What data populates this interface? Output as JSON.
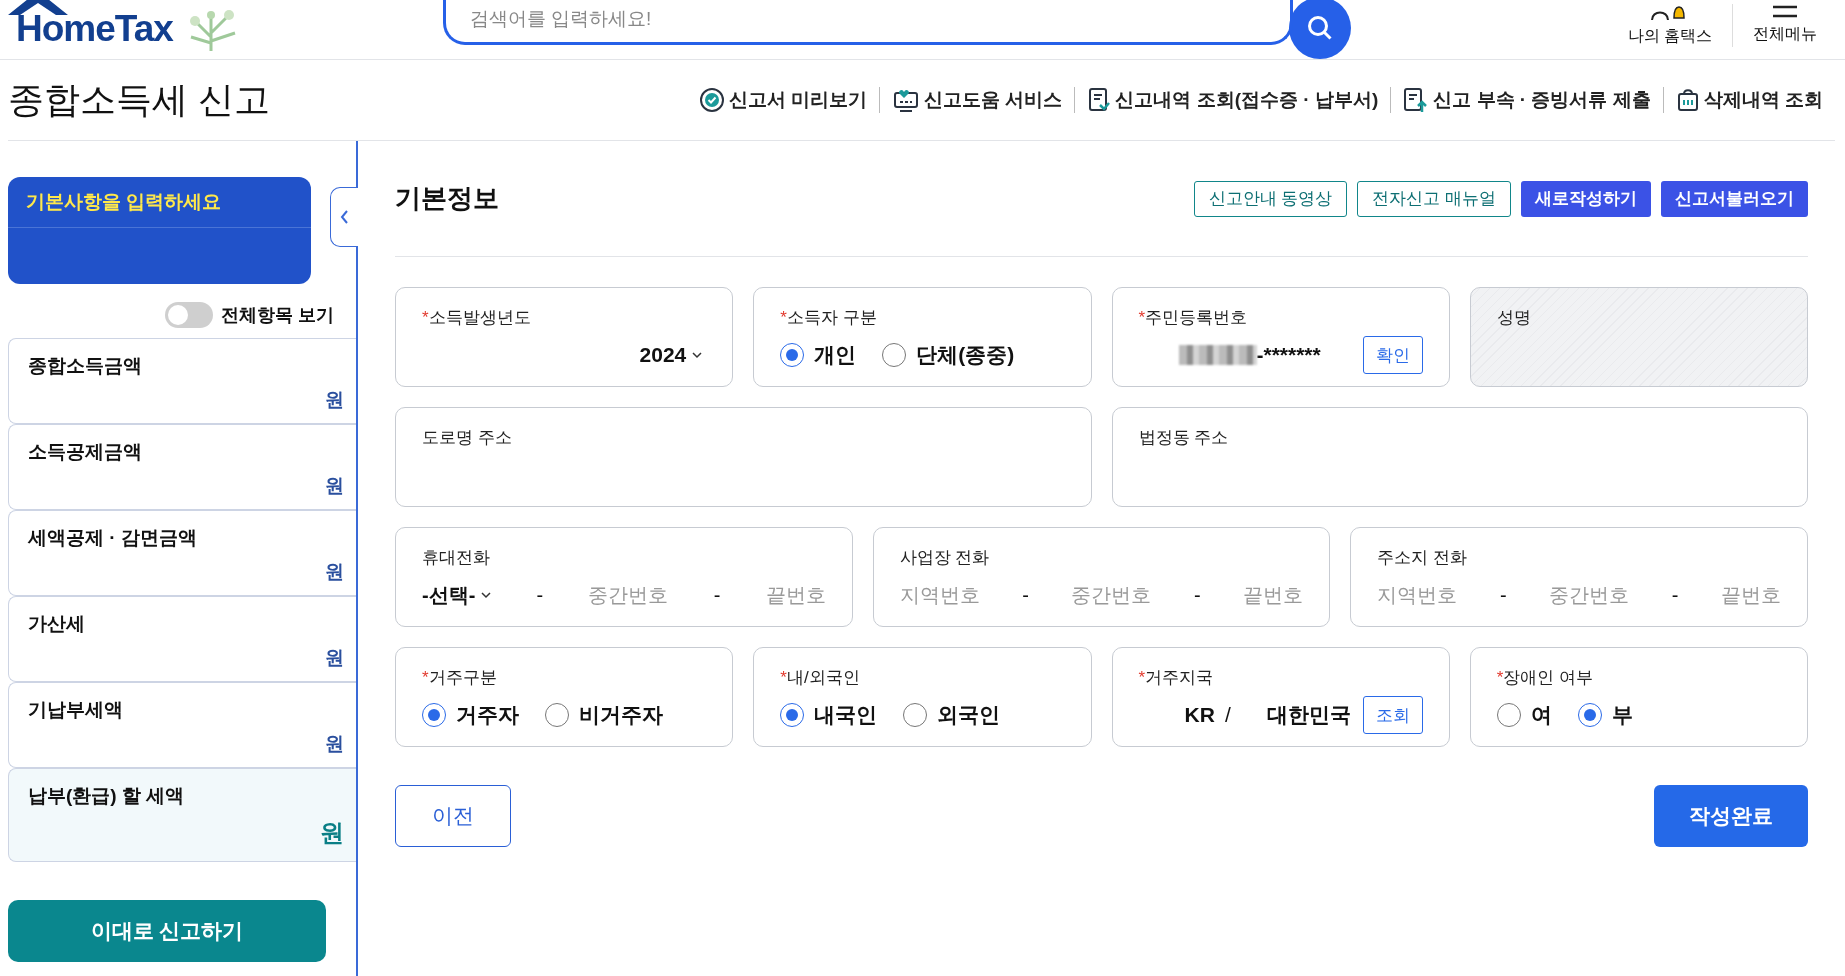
{
  "header": {
    "logo": "HomeTax",
    "search": {
      "placeholder": "검색어를 입력하세요!"
    },
    "actions": [
      {
        "label": "나의 홈택스",
        "kind": "bell"
      },
      {
        "label": "전체메뉴",
        "kind": "menu"
      }
    ]
  },
  "page_title": "종합소득세 신고",
  "top_links": [
    {
      "label": "신고서 미리보기",
      "kind": "preview"
    },
    {
      "label": "신고도움 서비스",
      "kind": "help"
    },
    {
      "label": "신고내역 조회(접수증 · 납부서)",
      "kind": "history"
    },
    {
      "label": "신고 부속 · 증빙서류 제출",
      "kind": "upload"
    },
    {
      "label": "삭제내역 조회",
      "kind": "trash"
    }
  ],
  "sidebar": {
    "banner": "기본사항을 입력하세요",
    "toggle": {
      "label": "전체항목 보기",
      "on": false
    },
    "items": [
      {
        "label": "종합소득금액",
        "unit": "원",
        "highlight": false
      },
      {
        "label": "소득공제금액",
        "unit": "원",
        "highlight": false
      },
      {
        "label": "세액공제 · 감면금액",
        "unit": "원",
        "highlight": false
      },
      {
        "label": "가산세",
        "unit": "원",
        "highlight": false
      },
      {
        "label": "기납부세액",
        "unit": "원",
        "highlight": false
      },
      {
        "label": "납부(환급) 할 세액",
        "unit": "원",
        "highlight": true
      }
    ],
    "submit": "이대로 신고하기"
  },
  "section": {
    "title": "기본정보",
    "buttons": [
      {
        "label": "신고안내 동영상",
        "kind": "outline"
      },
      {
        "label": "전자신고 매뉴얼",
        "kind": "outline"
      },
      {
        "label": "새로작성하기",
        "kind": "solid"
      },
      {
        "label": "신고서불러오기",
        "kind": "solid"
      }
    ]
  },
  "rows": [
    [
      {
        "kind": "select",
        "mark": "*",
        "label": "소득발생년도",
        "value": "2024"
      },
      {
        "kind": "radio",
        "mark": "*",
        "label": "소득자 구분",
        "options": [
          {
            "label": "개인",
            "selected": true
          },
          {
            "label": "단체(종중)",
            "selected": false
          }
        ]
      },
      {
        "kind": "id",
        "mark": "*",
        "label": "주민등록번호",
        "value": "-*******",
        "button": "확인"
      },
      {
        "kind": "readonly",
        "label": "성명"
      }
    ],
    [
      {
        "kind": "text",
        "label": "도로명 주소"
      },
      {
        "kind": "text",
        "label": "법정동 주소"
      }
    ],
    [
      {
        "kind": "phone",
        "label": "휴대전화",
        "parts": [
          {
            "kind": "select",
            "text": "-선택-"
          },
          {
            "kind": "sep",
            "text": "-"
          },
          {
            "kind": "placeholder",
            "text": "중간번호"
          },
          {
            "kind": "sep",
            "text": "-"
          },
          {
            "kind": "placeholder",
            "text": "끝번호"
          }
        ]
      },
      {
        "kind": "phone",
        "label": "사업장 전화",
        "parts": [
          {
            "kind": "placeholder",
            "text": "지역번호"
          },
          {
            "kind": "sep",
            "text": "-"
          },
          {
            "kind": "placeholder",
            "text": "중간번호"
          },
          {
            "kind": "sep",
            "text": "-"
          },
          {
            "kind": "placeholder",
            "text": "끝번호"
          }
        ]
      },
      {
        "kind": "phone",
        "label": "주소지 전화",
        "parts": [
          {
            "kind": "placeholder",
            "text": "지역번호"
          },
          {
            "kind": "sep",
            "text": "-"
          },
          {
            "kind": "placeholder",
            "text": "중간번호"
          },
          {
            "kind": "sep",
            "text": "-"
          },
          {
            "kind": "placeholder",
            "text": "끝번호"
          }
        ]
      }
    ],
    [
      {
        "kind": "radio",
        "mark": "*",
        "label": "거주구분",
        "options": [
          {
            "label": "거주자",
            "selected": true
          },
          {
            "label": "비거주자",
            "selected": false
          }
        ]
      },
      {
        "kind": "radio",
        "mark": "*",
        "label": "내/외국인",
        "options": [
          {
            "label": "내국인",
            "selected": true
          },
          {
            "label": "외국인",
            "selected": false
          }
        ]
      },
      {
        "kind": "country",
        "mark": "*",
        "label": "거주지국",
        "code": "KR",
        "slash": "/",
        "name": "대한민국",
        "button": "조회"
      },
      {
        "kind": "radio",
        "mark": "*",
        "label": "장애인 여부",
        "options": [
          {
            "label": "여",
            "selected": false
          },
          {
            "label": "부",
            "selected": true
          }
        ]
      }
    ]
  ],
  "footer": {
    "prev": "이전",
    "done": "작성완료"
  }
}
